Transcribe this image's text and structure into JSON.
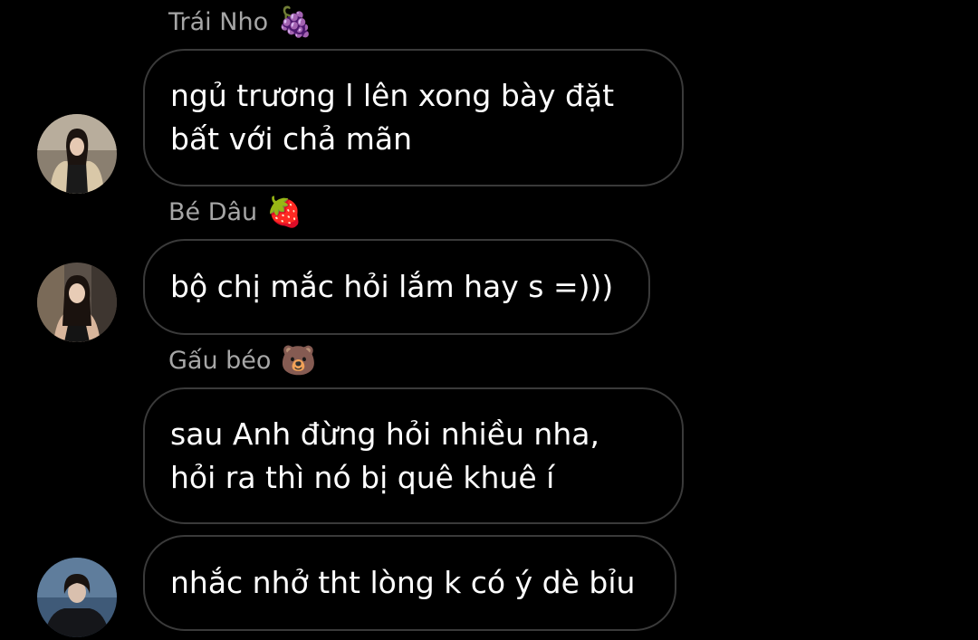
{
  "theme": {
    "background": "#000000",
    "bubble_border": "#3a3a3a",
    "sender_name_color": "#a6a6a6",
    "message_text_color": "#ffffff"
  },
  "messages": [
    {
      "sender": "Trái Nho",
      "sender_emoji": "🍇",
      "emoji_name": "grapes-emoji",
      "lines": [
        "ngủ trương l lên xong bày đặt",
        "bất với chả mãn"
      ],
      "show_avatar": true
    },
    {
      "sender": "Bé Dâu",
      "sender_emoji": "🍓",
      "emoji_name": "strawberry-emoji",
      "lines": [
        "bộ chị mắc hỏi lắm hay s =)))"
      ],
      "show_avatar": true
    },
    {
      "sender": "Gấu béo",
      "sender_emoji": "🐻",
      "emoji_name": "bear-emoji",
      "lines": [
        "sau Anh đừng hỏi nhiều nha,",
        "hỏi ra thì nó bị quê khuê í"
      ],
      "show_avatar": false
    },
    {
      "sender": "",
      "sender_emoji": "",
      "lines": [
        "nhắc nhở tht lòng k có ý dè bỉu"
      ],
      "show_avatar": true
    }
  ]
}
